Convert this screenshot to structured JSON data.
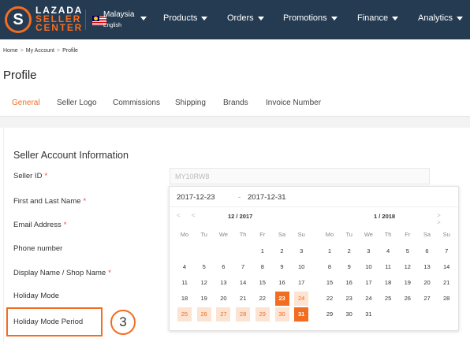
{
  "brand": {
    "line1": "LAZADA",
    "line2": "SELLER",
    "line3": "CENTER",
    "mark": "S",
    "accent": "#f36d21",
    "nav_bg": "#243b52"
  },
  "locale": {
    "country": "Malaysia",
    "language": "English",
    "flag_icon": "malaysia-flag-icon"
  },
  "nav": [
    "Products",
    "Orders",
    "Promotions",
    "Finance",
    "Analytics"
  ],
  "breadcrumb": [
    "Home",
    "My Account",
    "Profile"
  ],
  "page_title": "Profile",
  "tabs": [
    "General",
    "Seller Logo",
    "Commissions",
    "Shipping",
    "Brands",
    "Invoice Number"
  ],
  "active_tab": "General",
  "section_title": "Seller Account Information",
  "fields": [
    {
      "label": "Seller ID",
      "required": "*"
    },
    {
      "label": "First and Last Name",
      "required": "*"
    },
    {
      "label": "Email Address",
      "required": "*"
    },
    {
      "label": "Phone number",
      "required": ""
    },
    {
      "label": "Display Name / Shop Name",
      "required": "*"
    },
    {
      "label": "Holiday Mode",
      "required": ""
    },
    {
      "label": "Holiday Mode Period",
      "required": ""
    }
  ],
  "seller_id_value": "MY10RW8",
  "step_number": "3",
  "date_range": {
    "start": "2017-12-23",
    "separator": "-",
    "end": "2017-12-31"
  },
  "calendars": [
    {
      "month_label": "12 /  2017",
      "nav": "< <",
      "weekdays": [
        "Mo",
        "Tu",
        "We",
        "Th",
        "Fr",
        "Sa",
        "Su"
      ],
      "weeks": [
        [
          "",
          "",
          "",
          "",
          "1",
          "2",
          "3"
        ],
        [
          "4",
          "5",
          "6",
          "7",
          "8",
          "9",
          "10"
        ],
        [
          "11",
          "12",
          "13",
          "14",
          "15",
          "16",
          "17"
        ],
        [
          "18",
          "19",
          "20",
          "21",
          "22",
          "23",
          "24"
        ],
        [
          "25",
          "26",
          "27",
          "28",
          "29",
          "30",
          "31"
        ]
      ]
    },
    {
      "month_label": "1 /  2018",
      "nav": "> >",
      "weekdays": [
        "Mo",
        "Tu",
        "We",
        "Th",
        "Fr",
        "Sa",
        "Su"
      ],
      "weeks": [
        [
          "1",
          "2",
          "3",
          "4",
          "5",
          "6",
          "7"
        ],
        [
          "8",
          "9",
          "10",
          "11",
          "12",
          "13",
          "14"
        ],
        [
          "15",
          "16",
          "17",
          "18",
          "19",
          "20",
          "21"
        ],
        [
          "22",
          "23",
          "24",
          "25",
          "26",
          "27",
          "28"
        ],
        [
          "29",
          "30",
          "31",
          "",
          "",
          "",
          ""
        ]
      ]
    }
  ],
  "selection": {
    "month_index": 0,
    "start_day": "23",
    "end_day": "31"
  }
}
